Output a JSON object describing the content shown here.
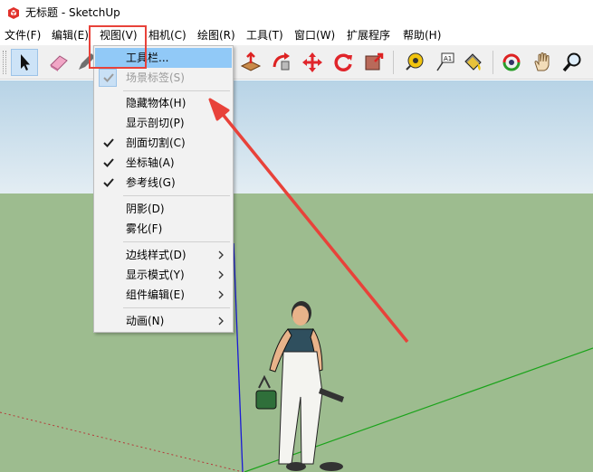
{
  "window": {
    "title": "无标题 - SketchUp",
    "app_icon": "sketchup-logo-icon"
  },
  "menubar": {
    "items": [
      "文件(F)",
      "编辑(E)",
      "视图(V)",
      "相机(C)",
      "绘图(R)",
      "工具(T)",
      "窗口(W)",
      "扩展程序",
      "帮助(H)"
    ]
  },
  "toolbar": {
    "tools": [
      "select-tool-icon",
      "eraser-tool-icon",
      "pencil-tool-icon",
      "push-pull-tool-icon",
      "follow-me-tool-icon",
      "move-tool-icon",
      "rotate-tool-icon",
      "scale-tool-icon",
      "tape-measure-tool-icon",
      "text-tool-icon",
      "paint-bucket-tool-icon",
      "orbit-tool-icon",
      "pan-tool-icon",
      "zoom-tool-icon"
    ]
  },
  "view_menu": {
    "items": [
      {
        "label": "工具栏...",
        "state": "highlighted"
      },
      {
        "label": "场景标签(S)",
        "state": "disabled",
        "checked": true
      },
      {
        "label": "隐藏物体(H)"
      },
      {
        "label": "显示剖切(P)"
      },
      {
        "label": "剖面切割(C)",
        "checked": true
      },
      {
        "label": "坐标轴(A)",
        "checked": true
      },
      {
        "label": "参考线(G)",
        "checked": true
      },
      {
        "label": "阴影(D)"
      },
      {
        "label": "雾化(F)"
      },
      {
        "label": "边线样式(D)",
        "submenu": true
      },
      {
        "label": "显示模式(Y)",
        "submenu": true
      },
      {
        "label": "组件编辑(E)",
        "submenu": true
      },
      {
        "label": "动画(N)",
        "submenu": true
      }
    ]
  },
  "colors": {
    "annotation": "#e8423a",
    "sky_top": "#b7d3e6",
    "ground": "#9dbc8f",
    "menu_highlight": "#91c9f7",
    "axis_green": "#1aa31a",
    "axis_blue": "#1a1ad6",
    "axis_red": "#b53a3a"
  }
}
